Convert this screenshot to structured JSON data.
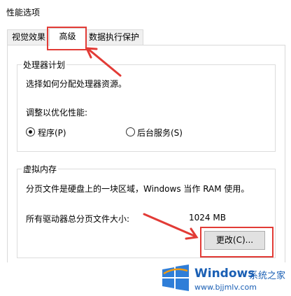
{
  "window": {
    "title": "性能选项"
  },
  "tabs": [
    {
      "label": "视觉效果",
      "active": false
    },
    {
      "label": "高级",
      "active": true
    },
    {
      "label": "数据执行保护",
      "active": false
    }
  ],
  "processor_scheduling": {
    "title": "处理器计划",
    "description": "选择如何分配处理器资源。",
    "adjust_label": "调整以优化性能:",
    "options": [
      {
        "label": "程序(P)",
        "selected": true
      },
      {
        "label": "后台服务(S)",
        "selected": false
      }
    ]
  },
  "virtual_memory": {
    "title": "虚拟内存",
    "description": "分页文件是硬盘上的一块区域，Windows 当作 RAM 使用。",
    "total_label": "所有驱动器总分页文件大小:",
    "total_value": "1024 MB",
    "change_button": "更改(C)..."
  },
  "watermark": {
    "brand": "Windows",
    "brand_cn": "系统之家",
    "url": "www.bjjmlv.com"
  },
  "colors": {
    "highlight": "#e23b36",
    "watermark": "#1a5fb4"
  }
}
